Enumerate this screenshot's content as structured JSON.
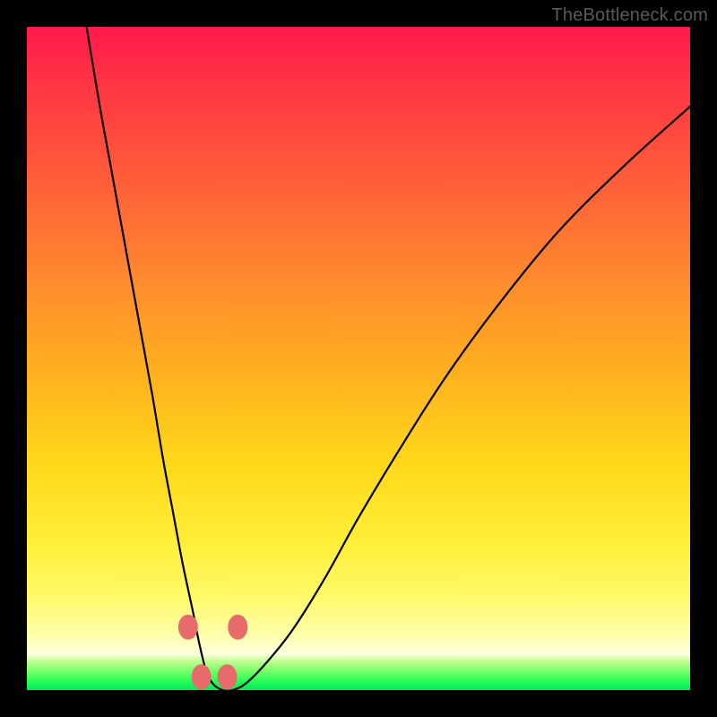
{
  "watermark": "TheBottleneck.com",
  "chart_data": {
    "type": "line",
    "title": "",
    "xlabel": "",
    "ylabel": "",
    "xlim": [
      0,
      100
    ],
    "ylim": [
      0,
      100
    ],
    "series": [
      {
        "name": "bottleneck-curve",
        "x": [
          9,
          11,
          13,
          15,
          17,
          19,
          20.5,
          22,
          23.5,
          25,
          26,
          27,
          28,
          29.5,
          31,
          33,
          36,
          40,
          45,
          50,
          56,
          63,
          71,
          80,
          90,
          100
        ],
        "values": [
          100,
          88,
          77,
          66,
          55,
          44,
          35,
          27,
          19,
          12,
          7,
          3,
          1,
          0,
          0,
          1,
          4,
          9,
          17,
          26,
          36,
          47,
          58,
          69,
          79,
          88
        ]
      }
    ],
    "markers": {
      "name": "highlight-dots",
      "color": "#e76b6b",
      "points": [
        {
          "x": 24.3,
          "y": 9.5
        },
        {
          "x": 31.8,
          "y": 9.5
        },
        {
          "x": 26.3,
          "y": 2.0
        },
        {
          "x": 30.2,
          "y": 2.0
        }
      ]
    }
  }
}
